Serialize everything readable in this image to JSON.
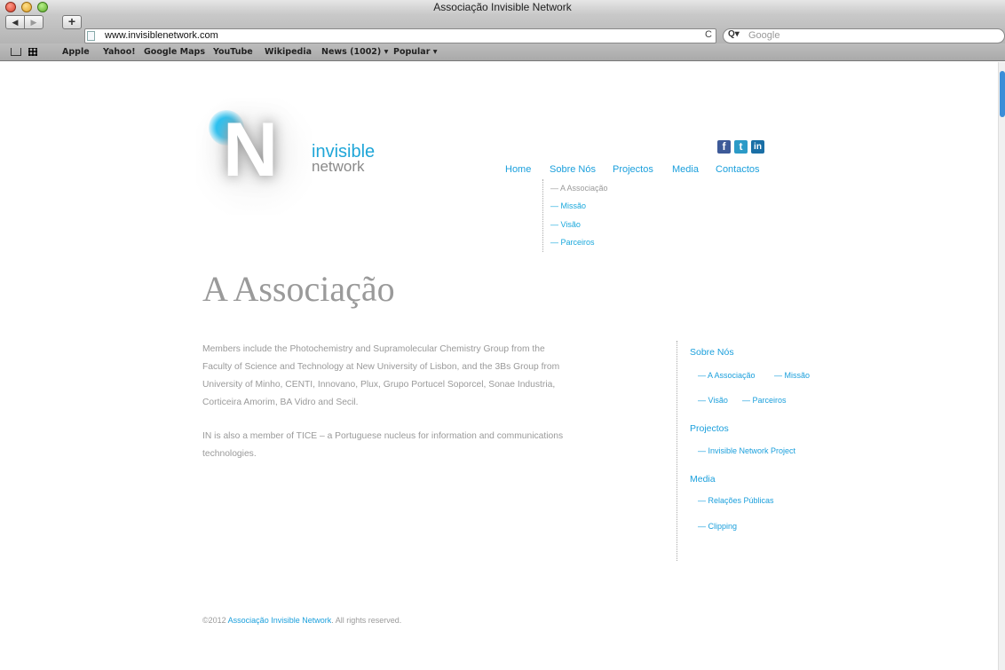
{
  "browser": {
    "window_title": "Associação Invisible Network",
    "url": "www.invisiblenetwork.com",
    "search_placeholder": "Google",
    "back_glyph": "◀",
    "forward_glyph": "▶",
    "add_glyph": "+",
    "reload_glyph": "C",
    "search_glyph": "Q▾",
    "bookmarks": [
      "Apple",
      "Yahoo!",
      "Google Maps",
      "YouTube",
      "Wikipedia",
      "News (1002) ▾",
      "Popular ▾"
    ]
  },
  "logo": {
    "letter": "N",
    "line1": "invisible",
    "line2": "network"
  },
  "social": {
    "facebook": "f",
    "twitter": "t",
    "linkedin": "in"
  },
  "nav": {
    "items": [
      "Home",
      "Sobre Nós",
      "Projectos",
      "Media",
      "Contactos"
    ],
    "subitems": [
      "— A Associação",
      "— Missão",
      "— Visão",
      "— Parceiros"
    ]
  },
  "main": {
    "title": "A Associação",
    "paragraph1_lines": [
      "Members include the Photochemistry and Supramolecular Chemistry Group from the",
      "Faculty of Science and Technology at New University of Lisbon, and the 3Bs Group from",
      "University of Minho, CENTI, Innovano, Plux, Grupo Portucel Soporcel, Sonae Industria,",
      "Corticeira Amorim, BA Vidro and Secil."
    ],
    "paragraph2_lines": [
      "IN is also a member of TICE – a Portuguese nucleus for information and communications",
      "technologies."
    ]
  },
  "sidebar": {
    "sobre_title": "Sobre Nós",
    "sobre_items": [
      "— A Associação",
      "— Missão",
      "— Visão",
      "— Parceiros"
    ],
    "projectos_title": "Projectos",
    "projectos_items": [
      "— Invisible Network Project"
    ],
    "media_title": "Media",
    "media_items": [
      "— Relações Públicas",
      "— Clipping"
    ]
  },
  "footer": {
    "prefix": "©2012 ",
    "link": "Associação Invisible Network",
    "suffix": ". All rights reserved."
  },
  "colors": {
    "accent": "#1a9fdc",
    "text_gray": "#9a9a9a"
  }
}
